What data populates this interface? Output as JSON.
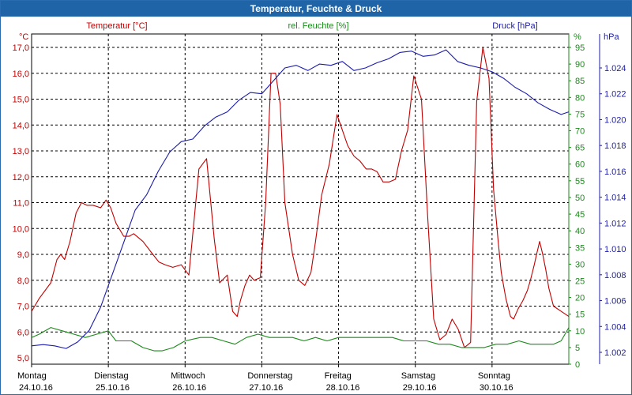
{
  "window": {
    "title": "Temperatur, Feuchte & Druck"
  },
  "colors": {
    "temperature": "#c00000",
    "humidity": "#1a8a1a",
    "pressure": "#1c1caa",
    "titlebar": "#1f64a6",
    "grid": "#000000"
  },
  "chart_data": {
    "type": "line",
    "title": "Temperatur, Feuchte & Druck",
    "grid": true,
    "axes": {
      "temperature": {
        "unit": "°C",
        "label": "Temperatur [°C]",
        "range": [
          5.0,
          17.0
        ],
        "ticks": [
          "5,0",
          "6,0",
          "7,0",
          "8,0",
          "9,0",
          "10,0",
          "11,0",
          "12,0",
          "13,0",
          "14,0",
          "15,0",
          "16,0",
          "17,0"
        ]
      },
      "humidity": {
        "unit": "%",
        "label": "rel. Feuchte [%]",
        "range": [
          0,
          95
        ],
        "ticks": [
          "0",
          "5",
          "10",
          "15",
          "20",
          "25",
          "30",
          "35",
          "40",
          "45",
          "50",
          "55",
          "60",
          "65",
          "70",
          "75",
          "80",
          "85",
          "90",
          "95"
        ]
      },
      "pressure": {
        "unit": "hPa",
        "label": "Druck [hPa]",
        "range": [
          1001.0,
          1026.0
        ],
        "ticks": [
          "1.002",
          "1.004",
          "1.006",
          "1.008",
          "1.010",
          "1.012",
          "1.014",
          "1.016",
          "1.018",
          "1.020",
          "1.022",
          "1.024"
        ],
        "tick_values": [
          1002,
          1004,
          1006,
          1008,
          1010,
          1012,
          1014,
          1016,
          1018,
          1020,
          1022,
          1024
        ]
      }
    },
    "x_range": [
      0,
      7
    ],
    "days": [
      {
        "name": "Montag",
        "date": "24.10.16"
      },
      {
        "name": "Dienstag",
        "date": "25.10.16"
      },
      {
        "name": "Mittwoch",
        "date": "26.10.16"
      },
      {
        "name": "Donnerstag",
        "date": "27.10.16"
      },
      {
        "name": "Freitag",
        "date": "28.10.16"
      },
      {
        "name": "Samstag",
        "date": "29.10.16"
      },
      {
        "name": "Sonntag",
        "date": "30.10.16"
      }
    ],
    "series": [
      {
        "name": "Temperatur [°C]",
        "axis": "temperature",
        "x": [
          0.0,
          0.1,
          0.25,
          0.33,
          0.38,
          0.43,
          0.5,
          0.58,
          0.65,
          0.72,
          0.8,
          0.9,
          0.97,
          1.03,
          1.1,
          1.2,
          1.27,
          1.33,
          1.45,
          1.58,
          1.66,
          1.74,
          1.84,
          1.95,
          2.05,
          2.18,
          2.28,
          2.38,
          2.45,
          2.55,
          2.62,
          2.68,
          2.72,
          2.78,
          2.84,
          2.9,
          2.98,
          3.05,
          3.12,
          3.18,
          3.24,
          3.3,
          3.4,
          3.48,
          3.56,
          3.64,
          3.7,
          3.78,
          3.88,
          3.98,
          4.05,
          4.12,
          4.2,
          4.28,
          4.36,
          4.43,
          4.5,
          4.58,
          4.66,
          4.74,
          4.82,
          4.9,
          4.98,
          5.08,
          5.16,
          5.24,
          5.32,
          5.4,
          5.48,
          5.56,
          5.64,
          5.72,
          5.8,
          5.88,
          5.96,
          6.02,
          6.08,
          6.12,
          6.18,
          6.24,
          6.28,
          6.34,
          6.4,
          6.46,
          6.5,
          6.55,
          6.58,
          6.62,
          6.66,
          6.7,
          6.74,
          6.8,
          6.9,
          7.0
        ],
        "y": [
          6.8,
          7.3,
          7.9,
          8.8,
          9.0,
          8.8,
          9.5,
          10.6,
          11.0,
          10.9,
          10.9,
          10.8,
          11.1,
          10.8,
          10.2,
          9.7,
          9.7,
          9.8,
          9.5,
          9.0,
          8.7,
          8.6,
          8.5,
          8.6,
          8.2,
          12.3,
          12.7,
          9.6,
          7.9,
          8.2,
          6.8,
          6.6,
          7.2,
          7.8,
          8.2,
          8.0,
          8.1,
          11.0,
          16.0,
          16.0,
          14.8,
          11.0,
          9.0,
          8.0,
          7.8,
          8.3,
          9.5,
          11.3,
          12.5,
          14.4,
          13.8,
          13.2,
          12.8,
          12.6,
          12.3,
          12.3,
          12.2,
          11.8,
          11.8,
          11.9,
          13.0,
          13.8,
          15.9,
          15.0,
          10.5,
          6.5,
          5.7,
          5.9,
          6.5,
          6.1,
          5.4,
          5.6,
          14.9,
          17.0,
          15.8,
          11.5,
          9.5,
          8.3,
          7.3,
          6.6,
          6.5,
          6.9,
          7.2,
          7.6,
          8.0,
          8.6,
          9.0,
          9.5,
          9.0,
          8.4,
          7.7,
          7.0,
          6.8,
          6.6
        ]
      },
      {
        "name": "rel. Feuchte [%]",
        "axis": "humidity",
        "x": [
          0.0,
          0.1,
          0.25,
          0.4,
          0.55,
          0.7,
          0.85,
          1.0,
          1.1,
          1.3,
          1.45,
          1.6,
          1.7,
          1.85,
          2.0,
          2.2,
          2.35,
          2.5,
          2.65,
          2.8,
          2.95,
          3.1,
          3.25,
          3.4,
          3.55,
          3.7,
          3.85,
          4.0,
          4.2,
          4.4,
          4.55,
          4.7,
          4.85,
          5.0,
          5.15,
          5.3,
          5.45,
          5.6,
          5.75,
          5.9,
          6.05,
          6.2,
          6.35,
          6.5,
          6.65,
          6.8,
          6.9,
          7.0
        ],
        "y": [
          8,
          9,
          11,
          10,
          9,
          8,
          9,
          10,
          7,
          7,
          5,
          4,
          4,
          5,
          7,
          8,
          8,
          7,
          6,
          8,
          9,
          8,
          8,
          8,
          7,
          8,
          7,
          8,
          8,
          8,
          8,
          8,
          7,
          7,
          7,
          6,
          6,
          5,
          5,
          5,
          6,
          6,
          7,
          6,
          6,
          6,
          7,
          11
        ]
      },
      {
        "name": "Druck [hPa]",
        "axis": "pressure",
        "x": [
          0.0,
          0.15,
          0.3,
          0.45,
          0.6,
          0.75,
          0.9,
          1.05,
          1.2,
          1.35,
          1.5,
          1.65,
          1.8,
          1.95,
          2.1,
          2.25,
          2.4,
          2.55,
          2.7,
          2.85,
          3.0,
          3.15,
          3.3,
          3.45,
          3.6,
          3.75,
          3.9,
          4.05,
          4.2,
          4.35,
          4.5,
          4.65,
          4.8,
          4.95,
          5.1,
          5.25,
          5.4,
          5.55,
          5.7,
          5.85,
          6.0,
          6.15,
          6.3,
          6.45,
          6.6,
          6.75,
          6.9,
          7.0
        ],
        "y": [
          1002.5,
          1002.6,
          1002.5,
          1002.3,
          1002.8,
          1003.7,
          1005.5,
          1008.0,
          1010.5,
          1013.0,
          1014.2,
          1016.0,
          1017.5,
          1018.3,
          1018.5,
          1019.5,
          1020.2,
          1020.6,
          1021.5,
          1022.1,
          1022.0,
          1023.0,
          1024.0,
          1024.2,
          1023.8,
          1024.3,
          1024.2,
          1024.5,
          1023.8,
          1024.0,
          1024.4,
          1024.7,
          1025.2,
          1025.3,
          1024.9,
          1025.0,
          1025.4,
          1024.5,
          1024.2,
          1024.0,
          1023.7,
          1023.2,
          1022.5,
          1022.0,
          1021.3,
          1020.8,
          1020.4,
          1020.6
        ]
      }
    ]
  }
}
